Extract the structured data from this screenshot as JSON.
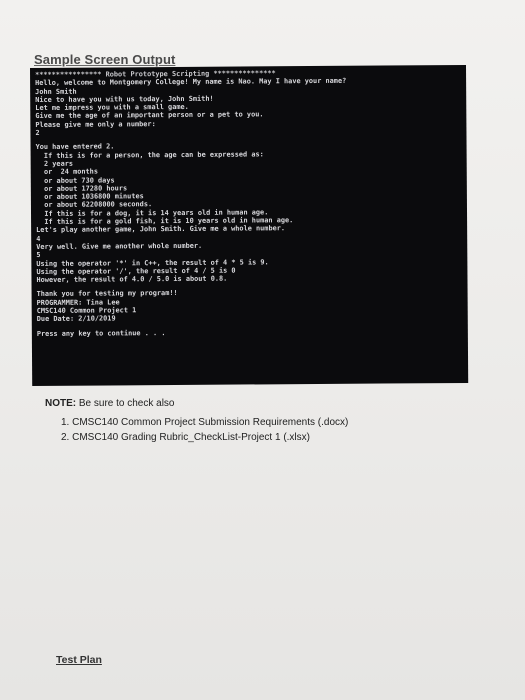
{
  "heading": "Sample Screen Output",
  "console": {
    "lines": [
      "**************** Robot Prototype Scripting ***************",
      "Hello, welcome to Montgomery College! My name is Nao. May I have your name?",
      "John Smith",
      "Nice to have you with us today, John Smith!",
      "Let me impress you with a small game.",
      "Give me the age of an important person or a pet to you.",
      "Please give me only a number:",
      "2",
      "",
      "You have entered 2.",
      "  If this is for a person, the age can be expressed as:",
      "  2 years",
      "  or  24 months",
      "  or about 730 days",
      "  or about 17280 hours",
      "  or about 1036800 minutes",
      "  or about 62208000 seconds.",
      "  If this is for a dog, it is 14 years old in human age.",
      "  If this is for a gold fish, it is 10 years old in human age.",
      "Let's play another game, John Smith. Give me a whole number.",
      "4",
      "Very well. Give me another whole number.",
      "5",
      "Using the operator '*' in C++, the result of 4 * 5 is 9.",
      "Using the operator '/', the result of 4 / 5 is 0",
      "However, the result of 4.0 / 5.0 is about 0.8.",
      "",
      "Thank you for testing my program!!",
      "PROGRAMMER: Tina Lee",
      "CMSC140 Common Project 1",
      "Due Date: 2/10/2019",
      "",
      "Press any key to continue . . ."
    ]
  },
  "note": {
    "label": "NOTE:",
    "text": " Be sure to check also",
    "items": [
      "1.  CMSC140 Common Project Submission Requirements (.docx)",
      "2.  CMSC140 Grading Rubric_CheckList-Project 1 (.xlsx)"
    ]
  },
  "footer_link": "Test Plan"
}
